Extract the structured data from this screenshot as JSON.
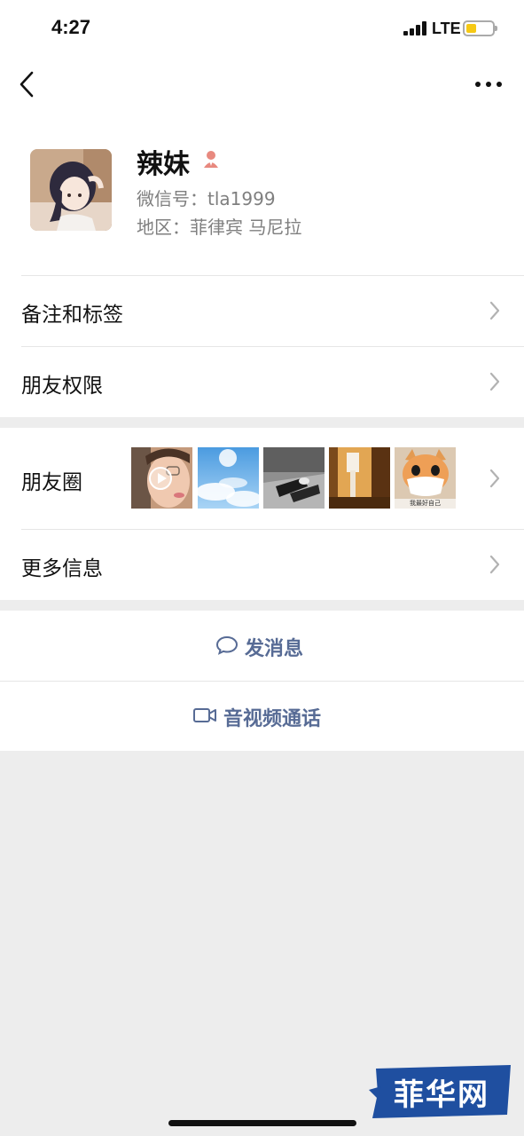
{
  "status_bar": {
    "time": "4:27",
    "network": "LTE"
  },
  "profile": {
    "name": "辣妹",
    "wechat_id": "微信号：tla1999",
    "region": "地区：菲律宾 马尼拉",
    "gender_icon": "female-icon",
    "gender_color": "#e8897f"
  },
  "rows": {
    "remarks_tags": "备注和标签",
    "friend_permissions": "朋友权限",
    "moments": "朋友圈",
    "more_info": "更多信息"
  },
  "moments_thumbnails": [
    "video-selfie",
    "blue-sky",
    "legs-black-white",
    "warm-room",
    "cat-mask"
  ],
  "moments_cat_caption": "我最好自己",
  "actions": {
    "send_message": "发消息",
    "video_call": "音视频通话"
  },
  "watermark": "菲华网",
  "colors": {
    "link_blue": "#576b95",
    "background": "#ededed",
    "watermark_blue": "#1f4fa0"
  }
}
